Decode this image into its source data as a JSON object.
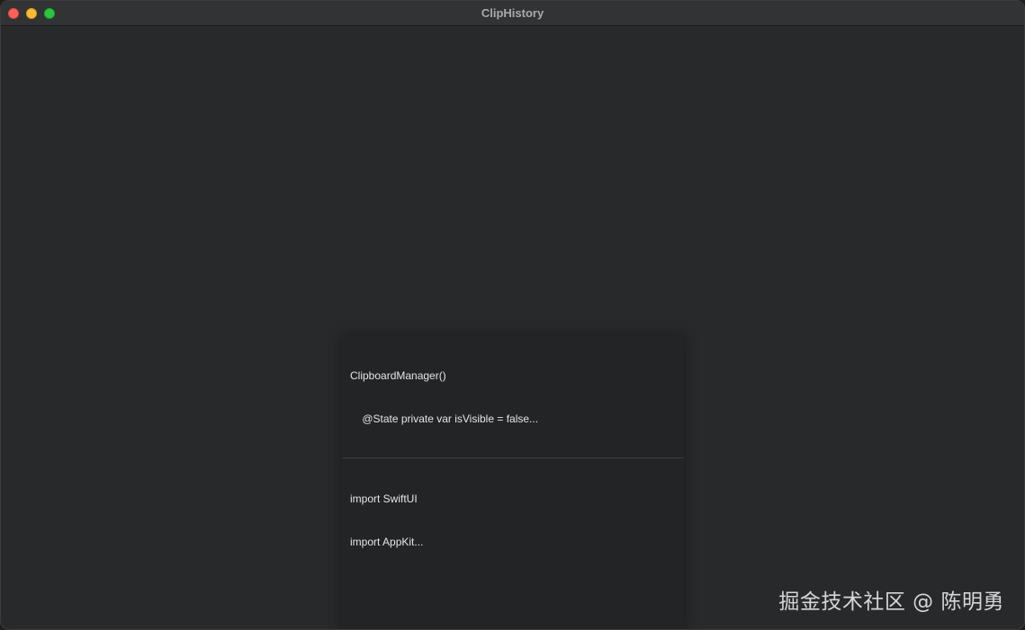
{
  "window": {
    "title": "ClipHistory"
  },
  "clipboard_items": [
    {
      "lines": [
        "ClipboardManager()",
        "    @State private var isVisible = false..."
      ]
    },
    {
      "lines": [
        "import SwiftUI",
        "import AppKit..."
      ]
    }
  ],
  "watermark": "掘金技术社区 @ 陈明勇",
  "colors": {
    "window_bg": "#27292b",
    "panel_bg": "#222426",
    "traffic_close": "#fe5f57",
    "traffic_minimize": "#febc2e",
    "traffic_zoom": "#28c840"
  }
}
